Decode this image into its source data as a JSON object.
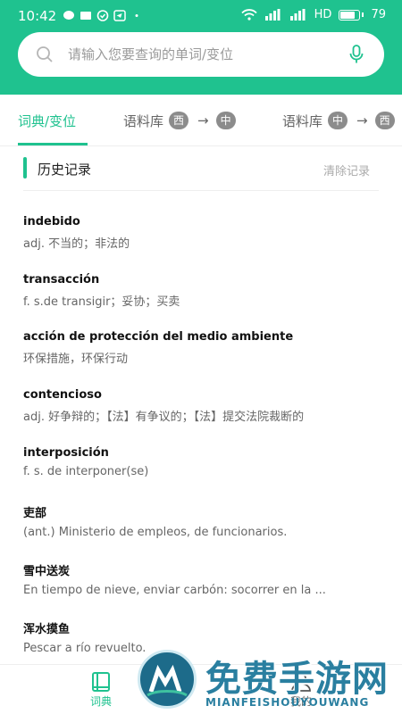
{
  "status_bar": {
    "time": "10:42",
    "network": "HD",
    "battery": "79"
  },
  "search": {
    "placeholder": "请输入您要查询的单词/变位"
  },
  "tabs": {
    "tab1": "词典/变位",
    "tab2_label": "语料库",
    "tab2_from": "西",
    "tab2_to": "中",
    "tab3_label": "语料库",
    "tab3_from": "中",
    "tab3_to": "西",
    "arrow": "→"
  },
  "history": {
    "title": "历史记录",
    "clear": "清除记录",
    "items": [
      {
        "word": "indebido",
        "def": "adj. 不当的；非法的"
      },
      {
        "word": "transacción",
        "def": "f. s.de transigir；妥协；买卖"
      },
      {
        "word": "acción de protección del medio ambiente",
        "def": "环保措施，环保行动"
      },
      {
        "word": "contencioso",
        "def": "adj. 好争辩的；【法】有争议的；【法】提交法院裁断的"
      },
      {
        "word": "interposición",
        "def": "f. s. de interponer(se)"
      },
      {
        "word": "吏部",
        "def": "(ant.) Ministerio de empleos, de funcionarios."
      },
      {
        "word": "雪中送炭",
        "def": "En tiempo de nieve, enviar carbón: socorrer en la ..."
      },
      {
        "word": "浑水摸鱼",
        "def": "Pescar a río revuelto."
      }
    ]
  },
  "bottom_nav": {
    "dict": "词典",
    "me": "我的"
  },
  "watermark": {
    "text": "免费手游网",
    "sub": "MIANFEISHOUYOUWANG"
  },
  "colors": {
    "accent": "#1fc28f"
  }
}
